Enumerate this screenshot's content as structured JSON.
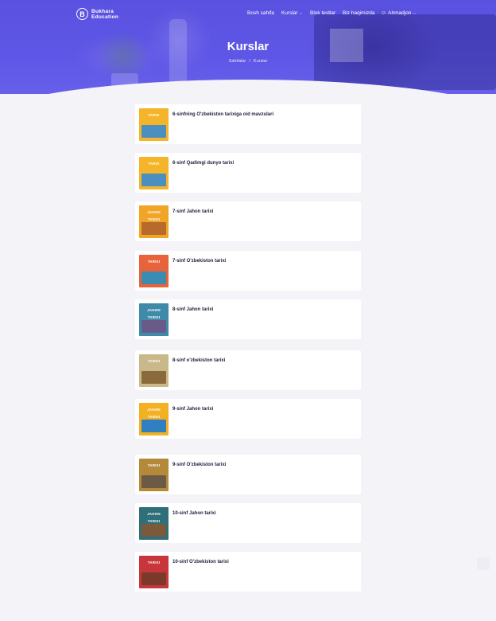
{
  "brand": {
    "line1": "Bukhara",
    "line2": "Education",
    "mark": "B"
  },
  "nav": {
    "home": "Bosh sahifa",
    "courses": "Kurslar",
    "tests": "Blok testlar",
    "about": "Biz haqimizda",
    "user": "Ahmadjon"
  },
  "page": {
    "title": "Kurslar",
    "breadcrumb": {
      "home": "Sahifalar",
      "separator": "/",
      "current": "Kurslar"
    }
  },
  "colors": {
    "primary": "#5b52e4",
    "card_title": "#1f1f3d",
    "background": "#f3f3f8"
  },
  "courses": [
    {
      "title": "6-sinfning O'zbekiston tarixiga oid mavzulari",
      "cover": {
        "label": "TARIX",
        "bg": "#f4b52a",
        "art": "#4a8fbf"
      }
    },
    {
      "title": "6-sinf Qadimgi dunyo tarixi",
      "cover": {
        "label": "TARIX",
        "bg": "#f4b52a",
        "art": "#4a8fbf"
      }
    },
    {
      "title": "7-sinf Jahon tarixi",
      "cover": {
        "label": "JAHON TARIXI",
        "bg": "#f0a526",
        "art": "#b76a2c"
      }
    },
    {
      "title": "7-sinf O'zbekiston tarixi",
      "cover": {
        "label": "TARIXI",
        "bg": "#e8633a",
        "art": "#3c8bb0"
      }
    },
    {
      "title": "8-sinf Jahon tarixi",
      "cover": {
        "label": "JAHON TARIXI",
        "bg": "#3f8aa8",
        "art": "#6a5a8a"
      }
    },
    {
      "title": "8-sinf o'zbekiston tarixi",
      "cover": {
        "label": "TARIXI",
        "bg": "#c9b98a",
        "art": "#8a6a3a"
      }
    },
    {
      "title": "9-sinf Jahon tarixi",
      "cover": {
        "label": "JAHON TARIXI",
        "bg": "#f3b023",
        "art": "#2f7fc1"
      }
    },
    {
      "title": "9-sinf O'zbekiston tarixi",
      "cover": {
        "label": "TARIXI",
        "bg": "#b48a3a",
        "art": "#6b5a45"
      }
    },
    {
      "title": "10-sinf Jahon tarixi",
      "cover": {
        "label": "JAHON TARIXI",
        "bg": "#2f6f7a",
        "art": "#7a5a3a"
      }
    },
    {
      "title": "10-sinf O'zbekiston tarixi",
      "cover": {
        "label": "TARIXI",
        "bg": "#c8353b",
        "art": "#7a3a2a"
      }
    }
  ]
}
